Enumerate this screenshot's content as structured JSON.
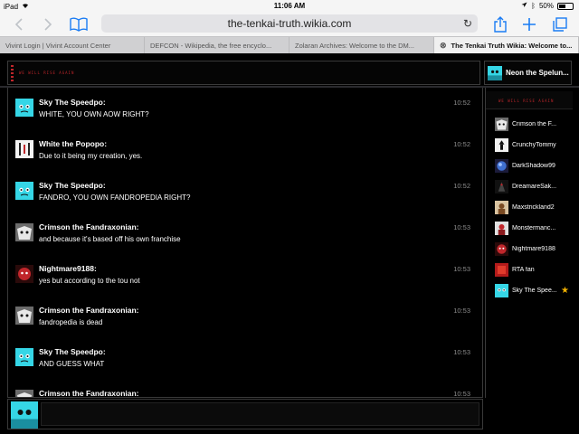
{
  "status_bar": {
    "device": "iPad",
    "time": "11:06 AM",
    "battery": "50%",
    "battery_level": 0.5
  },
  "browser": {
    "url": "the-tenkai-truth.wikia.com",
    "tabs": [
      {
        "label": "Vivint Login  |  Vivint Account Center",
        "active": false
      },
      {
        "label": "DEFCON - Wikipedia, the free encyclo...",
        "active": false
      },
      {
        "label": "Zolaran Archives: Welcome to the DM...",
        "active": false
      },
      {
        "label": "The Tenkai Truth Wikia: Welcome to...",
        "active": true
      }
    ]
  },
  "chat": {
    "banner_text": "WE WILL RISE AGAIN",
    "current_user": "Neon the Spelun...",
    "messages": [
      {
        "user": "Sky The Speedpo:",
        "text": "WHITE, YOU OWN AOW RIGHT?",
        "time": "10:52",
        "avatar": "cyan-face"
      },
      {
        "user": "White the Popopo:",
        "text": "Due to it being my creation, yes.",
        "time": "10:52",
        "avatar": "white-figure"
      },
      {
        "user": "Sky The Speedpo:",
        "text": "FANDRO, YOU OWN FANDROPEDIA RIGHT?",
        "time": "10:52",
        "avatar": "cyan-face"
      },
      {
        "user": "Crimson the Fandraxonian:",
        "text": "and because it's based off his own franchise",
        "time": "10:53",
        "avatar": "crimson-face"
      },
      {
        "user": "Nightmare9188:",
        "text": "yes but according to the tou not",
        "time": "10:53",
        "avatar": "nightmare-face"
      },
      {
        "user": "Crimson the Fandraxonian:",
        "text": "fandropedia is dead",
        "time": "10:53",
        "avatar": "crimson-face"
      },
      {
        "user": "Sky The Speedpo:",
        "text": "AND GUESS WHAT",
        "time": "10:53",
        "avatar": "cyan-face"
      },
      {
        "user": "Crimson the Fandraxonian:",
        "text": "",
        "time": "10:53",
        "avatar": "crimson-face"
      }
    ]
  },
  "userlist": {
    "banner_text": "WE WILL RISE AGAIN",
    "users": [
      {
        "name": "Crimson the F...",
        "avatar": "crimson-face",
        "star": false
      },
      {
        "name": "CrunchyTommy",
        "avatar": "white-figure",
        "star": false
      },
      {
        "name": "DarkShadow99",
        "avatar": "blue-orb",
        "star": false
      },
      {
        "name": "DreamareSak...",
        "avatar": "dark-figure",
        "star": false
      },
      {
        "name": "Maxstrickland2",
        "avatar": "brown-figure",
        "star": false
      },
      {
        "name": "Monstermanc...",
        "avatar": "red-figure",
        "star": false
      },
      {
        "name": "Nightmare9188",
        "avatar": "nightmare-face",
        "star": false
      },
      {
        "name": "RTA fan",
        "avatar": "red-block",
        "star": false
      },
      {
        "name": "Sky The Spee...",
        "avatar": "cyan-face",
        "star": true
      }
    ]
  },
  "compose": {
    "value": "",
    "placeholder": ""
  },
  "colors": {
    "accent": "#1a7cf4",
    "banner_red": "#c0262b",
    "cyan": "#35d6e6"
  }
}
